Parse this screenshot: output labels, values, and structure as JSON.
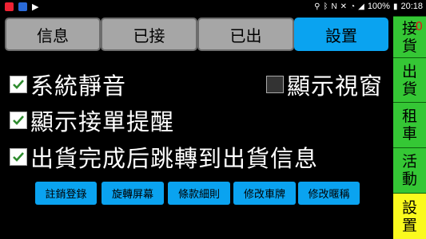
{
  "status_bar": {
    "battery": "100%",
    "time": "20:18"
  },
  "tabs": [
    {
      "label": "信息",
      "active": false
    },
    {
      "label": "已接",
      "active": false
    },
    {
      "label": "已出",
      "active": false
    },
    {
      "label": "設置",
      "active": true
    }
  ],
  "settings": {
    "mute": {
      "label": "系統靜音",
      "checked": true
    },
    "show_window": {
      "label": "顯示視窗",
      "checked": false
    },
    "order_reminder": {
      "label": "顯示接單提醒",
      "checked": true
    },
    "jump_after_ship": {
      "label": "出貨完成后跳轉到出貨信息",
      "checked": true
    }
  },
  "actions": [
    "註銷登錄",
    "旋轉屏幕",
    "條款細則",
    "修改車牌",
    "修改暱稱"
  ],
  "side_nav": [
    {
      "line1": "接",
      "line2": "貨",
      "badge": "0"
    },
    {
      "line1": "出",
      "line2": "貨"
    },
    {
      "line1": "租",
      "line2": "車"
    },
    {
      "line1": "活",
      "line2": "動"
    },
    {
      "line1": "設",
      "line2": "置",
      "active": true
    }
  ],
  "colors": {
    "background": "#000000",
    "tab_inactive": "#a6a6a6",
    "tab_active": "#0aa3f0",
    "button": "#0aa3f0",
    "side_nav": "#35c735",
    "side_nav_active": "#fafa1e",
    "badge": "#e01818",
    "check": "#2e8b2e"
  }
}
